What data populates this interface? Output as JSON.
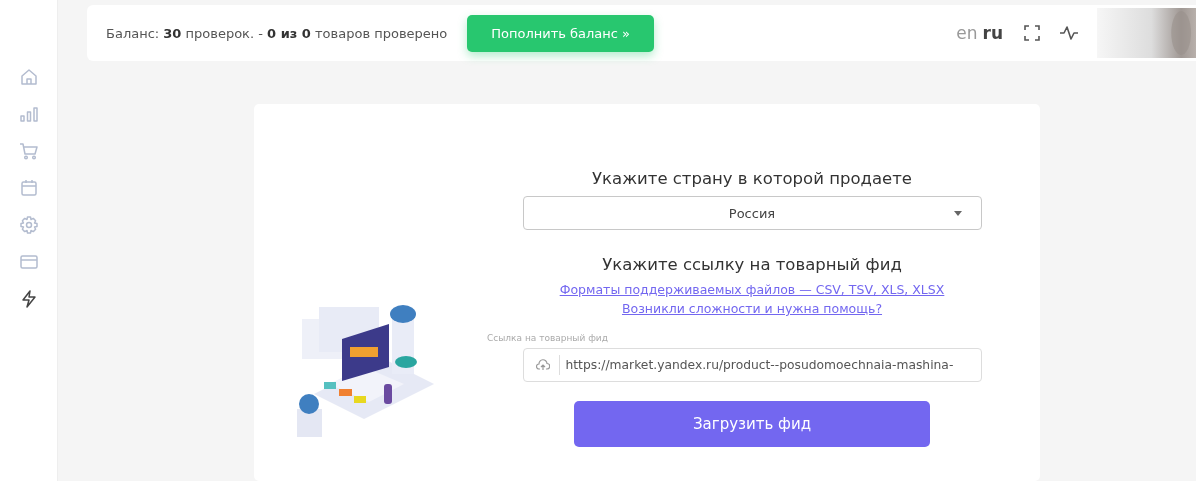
{
  "sidebar": {
    "items": [
      {
        "kind": "home",
        "selected": false
      },
      {
        "kind": "chart",
        "selected": false
      },
      {
        "kind": "cart",
        "selected": false
      },
      {
        "kind": "calendar",
        "selected": false
      },
      {
        "kind": "settings",
        "selected": false
      },
      {
        "kind": "card",
        "selected": false
      },
      {
        "kind": "bolt",
        "selected": true
      }
    ]
  },
  "header": {
    "balance": "Баланс: **30** проверок. - **0 из 0** товаров проверено",
    "topup_button": "Пополнить баланс »",
    "languages": [
      {
        "label": "en",
        "selected": false
      },
      {
        "label": "ru",
        "selected": true
      }
    ]
  },
  "form": {
    "country_title": "Укажите страну в которой продаете",
    "country_select": "Россия",
    "feed_title": "Укажите ссылку на товарный фид",
    "links": [
      "Форматы поддерживаемых файлов — CSV, TSV, XLS, XLSX",
      "Возникли сложности и нужна помощь?"
    ],
    "feed_field": {
      "label": "Ссылка на товарный фид",
      "value": "https://market.yandex.ru/product--posudomoechnaia-mashina-"
    },
    "submit_button": "Загрузить фид"
  }
}
